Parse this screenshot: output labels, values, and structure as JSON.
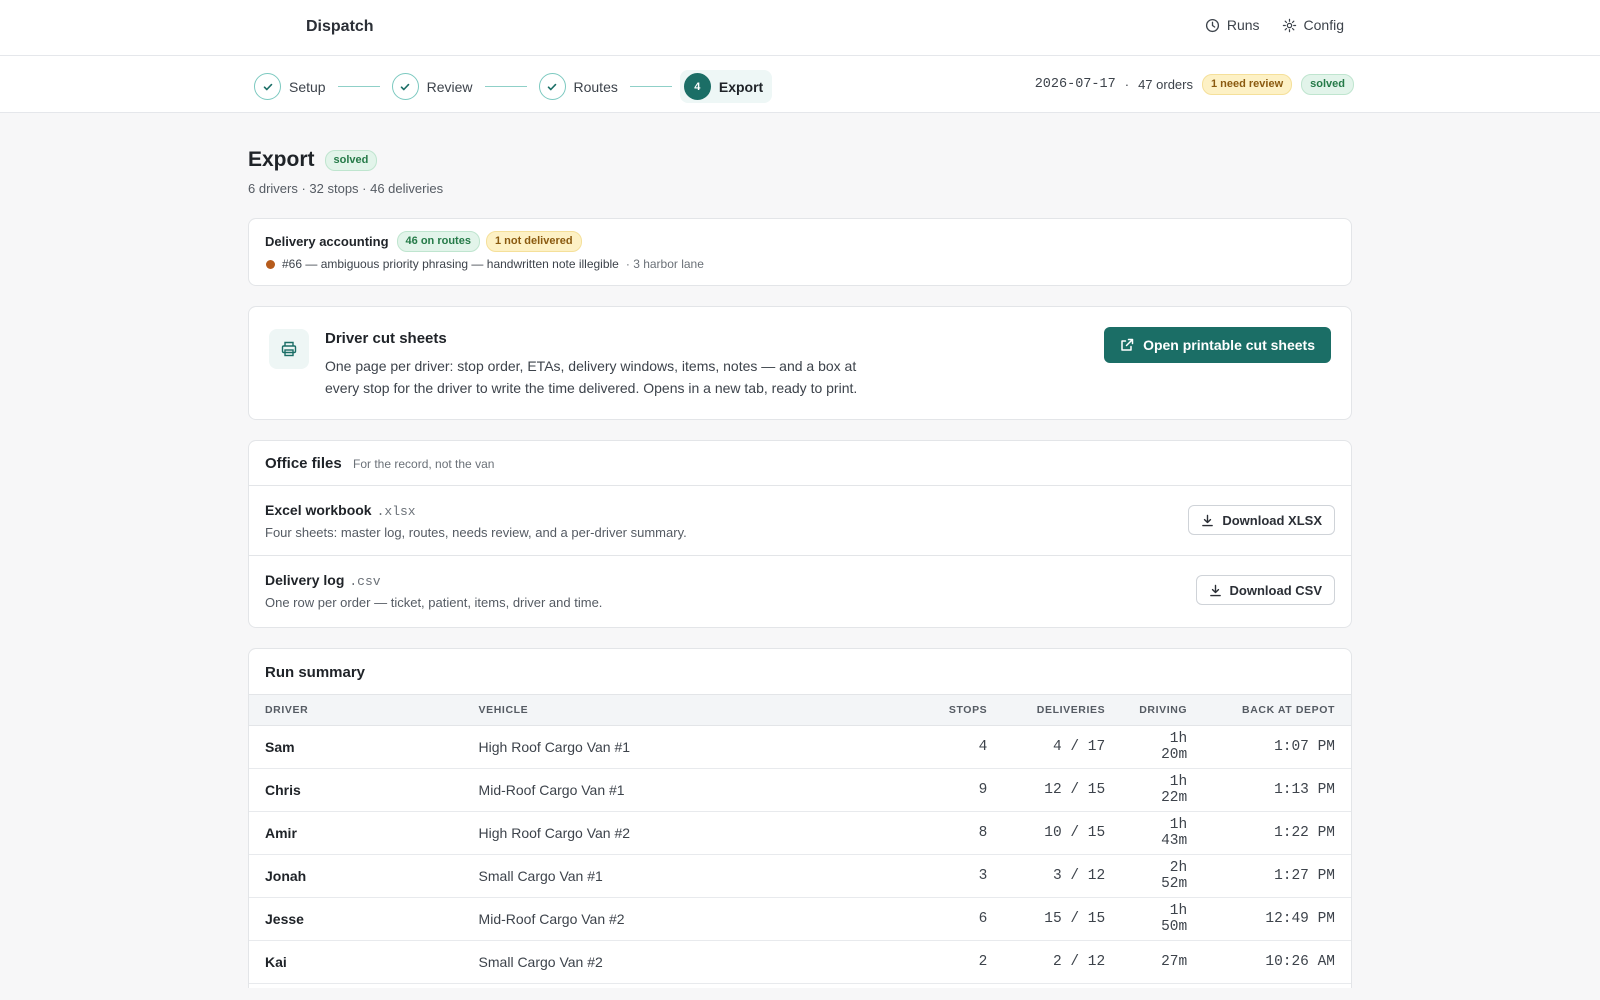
{
  "app": {
    "title": "Dispatch"
  },
  "topnav": [
    {
      "label": "Runs",
      "icon": "clock-icon"
    },
    {
      "label": "Config",
      "icon": "gear-icon"
    }
  ],
  "steps": [
    {
      "label": "Setup",
      "state": "done"
    },
    {
      "label": "Review",
      "state": "done"
    },
    {
      "label": "Routes",
      "state": "done"
    },
    {
      "label": "Export",
      "state": "active",
      "number": "4"
    }
  ],
  "runinfo": {
    "date": "2026-07-17",
    "separator": "·",
    "orders": "47 orders",
    "review_badge": "1 need review",
    "status_badge": "solved"
  },
  "page": {
    "title": "Export",
    "status_badge": "solved",
    "subtitle": "6 drivers · 32 stops · 46 deliveries"
  },
  "accounting": {
    "title": "Delivery accounting",
    "on_routes_badge": "46 on routes",
    "not_delivered_badge": "1 not delivered",
    "issue_text": "#66 — ambiguous priority phrasing — handwritten note illegible",
    "issue_location": "· 3 harbor lane"
  },
  "cutsheets": {
    "title": "Driver cut sheets",
    "description": "One page per driver: stop order, ETAs, delivery windows, items, notes — and a box at every stop for the driver to write the time delivered. Opens in a new tab, ready to print.",
    "button_label": "Open printable cut sheets"
  },
  "office_files": {
    "title": "Office files",
    "subtitle": "For the record, not the van",
    "files": [
      {
        "name": "Excel workbook",
        "ext": ".xlsx",
        "description": "Four sheets: master log, routes, needs review, and a per-driver summary.",
        "button": "Download XLSX"
      },
      {
        "name": "Delivery log",
        "ext": ".csv",
        "description": "One row per order — ticket, patient, items, driver and time.",
        "button": "Download CSV"
      }
    ]
  },
  "run_summary": {
    "title": "Run summary",
    "columns": [
      "DRIVER",
      "VEHICLE",
      "STOPS",
      "DELIVERIES",
      "DRIVING",
      "BACK AT DEPOT"
    ],
    "rows": [
      {
        "driver": "Sam",
        "vehicle": "High Roof Cargo Van #1",
        "stops": "4",
        "deliveries": "4 / 17",
        "driving": "1h 20m",
        "back": "1:07 PM"
      },
      {
        "driver": "Chris",
        "vehicle": "Mid-Roof Cargo Van #1",
        "stops": "9",
        "deliveries": "12 / 15",
        "driving": "1h 22m",
        "back": "1:13 PM"
      },
      {
        "driver": "Amir",
        "vehicle": "High Roof Cargo Van #2",
        "stops": "8",
        "deliveries": "10 / 15",
        "driving": "1h 43m",
        "back": "1:22 PM"
      },
      {
        "driver": "Jonah",
        "vehicle": "Small Cargo Van #1",
        "stops": "3",
        "deliveries": "3 / 12",
        "driving": "2h 52m",
        "back": "1:27 PM"
      },
      {
        "driver": "Jesse",
        "vehicle": "Mid-Roof Cargo Van #2",
        "stops": "6",
        "deliveries": "15 / 15",
        "driving": "1h 50m",
        "back": "12:49 PM"
      },
      {
        "driver": "Kai",
        "vehicle": "Small Cargo Van #2",
        "stops": "2",
        "deliveries": "2 / 12",
        "driving": "27m",
        "back": "10:26 AM"
      }
    ]
  },
  "colors": {
    "accent": "#1b6e66",
    "step_ring": "#7cc9c0",
    "warning_dot": "#b65b1c"
  }
}
